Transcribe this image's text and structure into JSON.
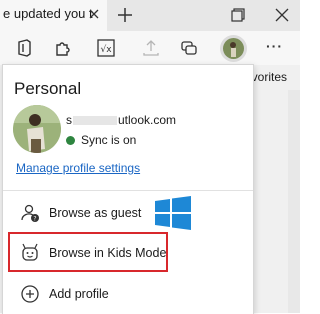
{
  "tab": {
    "title": "e updated you t",
    "close_icon": "close-icon"
  },
  "toolbar": {
    "icons": [
      "office-icon",
      "extensions-icon",
      "math-solver-icon",
      "share-icon",
      "collections-icon",
      "profile-avatar",
      "more-icon"
    ],
    "more_label": "···"
  },
  "page": {
    "favorites_text": "avorites"
  },
  "flyout": {
    "heading": "Personal",
    "email_prefix": "s",
    "email_suffix": "utlook.com",
    "sync_status": "Sync is on",
    "sync_color": "#2e8540",
    "manage_link": "Manage profile settings",
    "menu": [
      {
        "label": "Browse as guest",
        "icon": "guest-icon"
      },
      {
        "label": "Browse in Kids Mode",
        "icon": "kids-mode-icon"
      },
      {
        "label": "Add profile",
        "icon": "add-icon"
      }
    ],
    "highlight_color": "#d8282c",
    "link_color": "#1a66c4"
  }
}
